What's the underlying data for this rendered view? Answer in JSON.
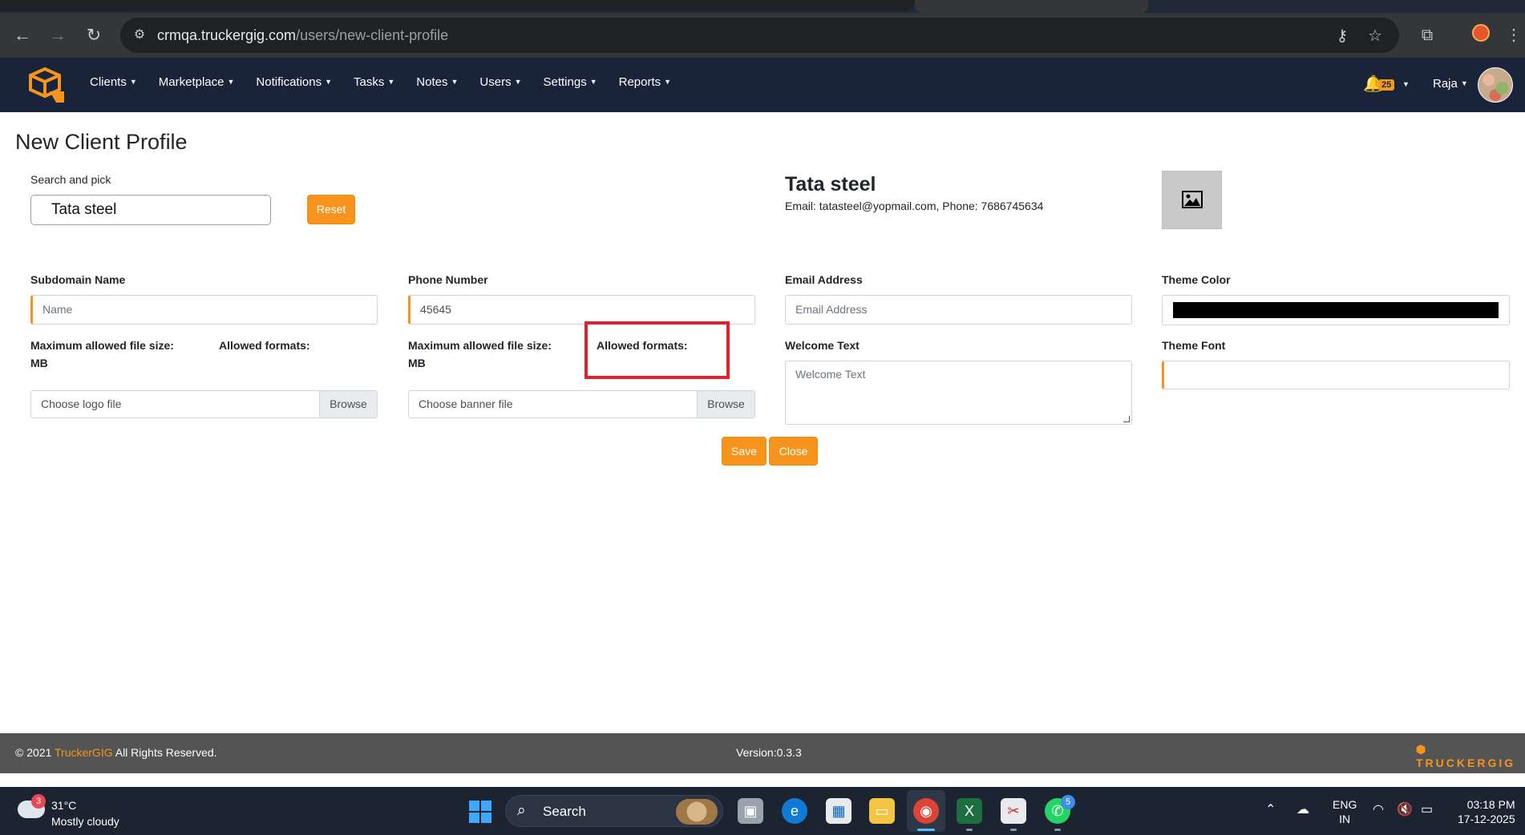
{
  "browser": {
    "url_host": "crmqa.truckergig.com",
    "url_path": "/users/new-client-profile"
  },
  "nav": {
    "menu": [
      "Clients",
      "Marketplace",
      "Notifications",
      "Tasks",
      "Notes",
      "Users",
      "Settings",
      "Reports"
    ],
    "notification_count": "25",
    "user_name": "Raja"
  },
  "page": {
    "title": "New Client Profile",
    "search_label": "Search and pick",
    "search_value": "Tata steel",
    "reset_label": "Reset",
    "client_name": "Tata steel",
    "client_info": "Email: tatasteel@yopmail.com, Phone: 7686745634"
  },
  "form": {
    "subdomain_label": "Subdomain Name",
    "subdomain_placeholder": "Name",
    "phone_label": "Phone Number",
    "phone_value": "45645",
    "email_label": "Email Address",
    "email_placeholder": "Email Address",
    "theme_color_label": "Theme Color",
    "theme_color_value": "#000000",
    "logo_max_size": "Maximum allowed file size:",
    "logo_mb": "MB",
    "logo_formats": "Allowed formats:",
    "banner_max_size": "Maximum allowed file size:",
    "banner_mb": "MB",
    "banner_formats": "Allowed formats:",
    "welcome_label": "Welcome Text",
    "welcome_placeholder": "Welcome Text",
    "theme_font_label": "Theme Font",
    "logo_file_placeholder": "Choose logo file",
    "banner_file_placeholder": "Choose banner file",
    "browse_label": "Browse",
    "save_label": "Save",
    "close_label": "Close"
  },
  "footer": {
    "copyright_prefix": "© 2021 ",
    "brand": "TruckerGIG",
    "copyright_suffix": " All Rights Reserved.",
    "version": "Version:0.3.3",
    "logo_text_accent": "TRUCKERGIG",
    "logo_text_rest": ""
  },
  "taskbar": {
    "weather_badge": "3",
    "temperature": "31°C",
    "weather_desc": "Mostly cloudy",
    "search_label": "Search",
    "whatsapp_badge": "5",
    "lang_top": "ENG",
    "lang_bottom": "IN",
    "time": "03:18 PM",
    "date": "17-12-2025"
  },
  "colors": {
    "accent": "#f7941d",
    "navbar": "#19233a",
    "footer": "#545454",
    "highlight": "#e3202b"
  }
}
